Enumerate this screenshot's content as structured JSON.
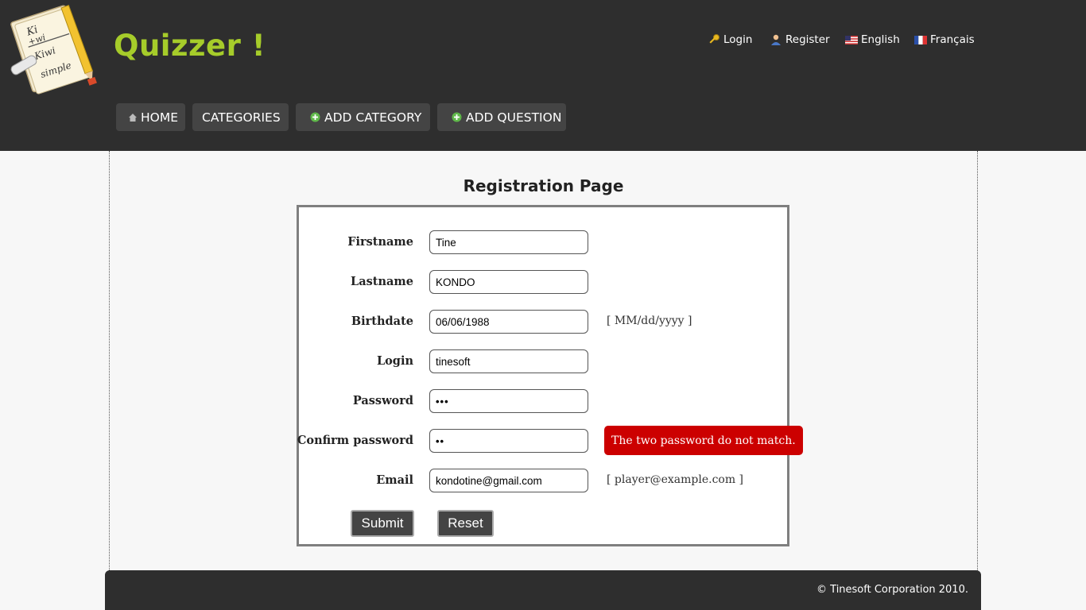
{
  "brand": {
    "title": "Quizzer !",
    "logo_icon": "notepad-pencil-logo",
    "color": "#a6cc2a"
  },
  "toplinks": {
    "login": {
      "label": "Login",
      "icon": "key-icon"
    },
    "register": {
      "label": "Register",
      "icon": "user-icon"
    },
    "english": {
      "label": "English",
      "icon": "us-flag-icon"
    },
    "french": {
      "label": "Français",
      "icon": "fr-flag-icon"
    }
  },
  "nav": {
    "home": {
      "label": "HOME",
      "icon": "house-icon"
    },
    "categories": {
      "label": "CATEGORIES"
    },
    "add_category": {
      "label": "ADD CATEGORY",
      "icon": "plus-circle-icon"
    },
    "add_question": {
      "label": "ADD QUESTION",
      "icon": "plus-circle-icon"
    }
  },
  "page": {
    "title": "Registration Page"
  },
  "form": {
    "firstname": {
      "label": "Firstname",
      "value": "Tine"
    },
    "lastname": {
      "label": "Lastname",
      "value": "KONDO"
    },
    "birthdate": {
      "label": "Birthdate",
      "value": "06/06/1988",
      "hint": "[ MM/dd/yyyy ]"
    },
    "login": {
      "label": "Login",
      "value": "tinesoft"
    },
    "password": {
      "label": "Password",
      "value": "•••"
    },
    "confirm_password": {
      "label": "Confirm password",
      "value": "••",
      "error": "The two password do not match."
    },
    "email": {
      "label": "Email",
      "value": "kondotine@gmail.com",
      "hint": "[ player@example.com ]"
    },
    "submit_label": "Submit",
    "reset_label": "Reset"
  },
  "footer": {
    "copyright": "© Tinesoft Corporation 2010."
  },
  "colors": {
    "header_bg": "#2e2e2e",
    "error_bg": "#cc0000",
    "nav_bg": "#444444"
  }
}
